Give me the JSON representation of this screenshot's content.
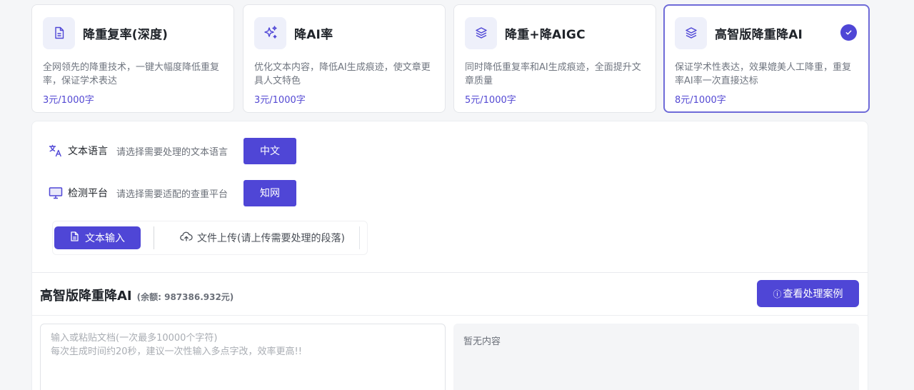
{
  "services": [
    {
      "icon": "document-icon",
      "title": "降重复率(深度)",
      "desc": "全网领先的降重技术，一键大幅度降低重复率，保证学术表达",
      "price": "3元/1000字",
      "selected": false
    },
    {
      "icon": "sparkles-icon",
      "title": "降AI率",
      "desc": "优化文本内容，降低AI生成痕迹，使文章更具人文特色",
      "price": "3元/1000字",
      "selected": false
    },
    {
      "icon": "layers-icon",
      "title": "降重+降AIGC",
      "desc": "同时降低重复率和AI生成痕迹，全面提升文章质量",
      "price": "5元/1000字",
      "selected": false
    },
    {
      "icon": "layers-icon",
      "title": "高智版降重降AI",
      "desc": "保证学术性表达，效果媲美人工降重，重复率AI率一次直接达标",
      "price": "8元/1000字",
      "selected": true
    }
  ],
  "settings": {
    "language": {
      "icon": "translate-icon",
      "label": "文本语言",
      "hint": "请选择需要处理的文本语言",
      "value": "中文"
    },
    "platform": {
      "icon": "monitor-icon",
      "label": "检测平台",
      "hint": "请选择需要适配的查重平台",
      "value": "知网"
    }
  },
  "input_tabs": {
    "text_input": "文本输入",
    "file_upload": "文件上传(请上传需要处理的段落)"
  },
  "workspace": {
    "title": "高智版降重降AI",
    "balance": "(余额: 987386.932元)",
    "cases_button": "查看处理案例",
    "editor_placeholder": "输入或粘贴文档(一次最多10000个字符)\n每次生成时间约20秒，建议一次性输入多点字改，效率更高!!",
    "result_empty": "暂无内容"
  },
  "colors": {
    "accent": "#4f46d6",
    "price": "#5348d3",
    "selected_border": "#6f6bd8"
  }
}
